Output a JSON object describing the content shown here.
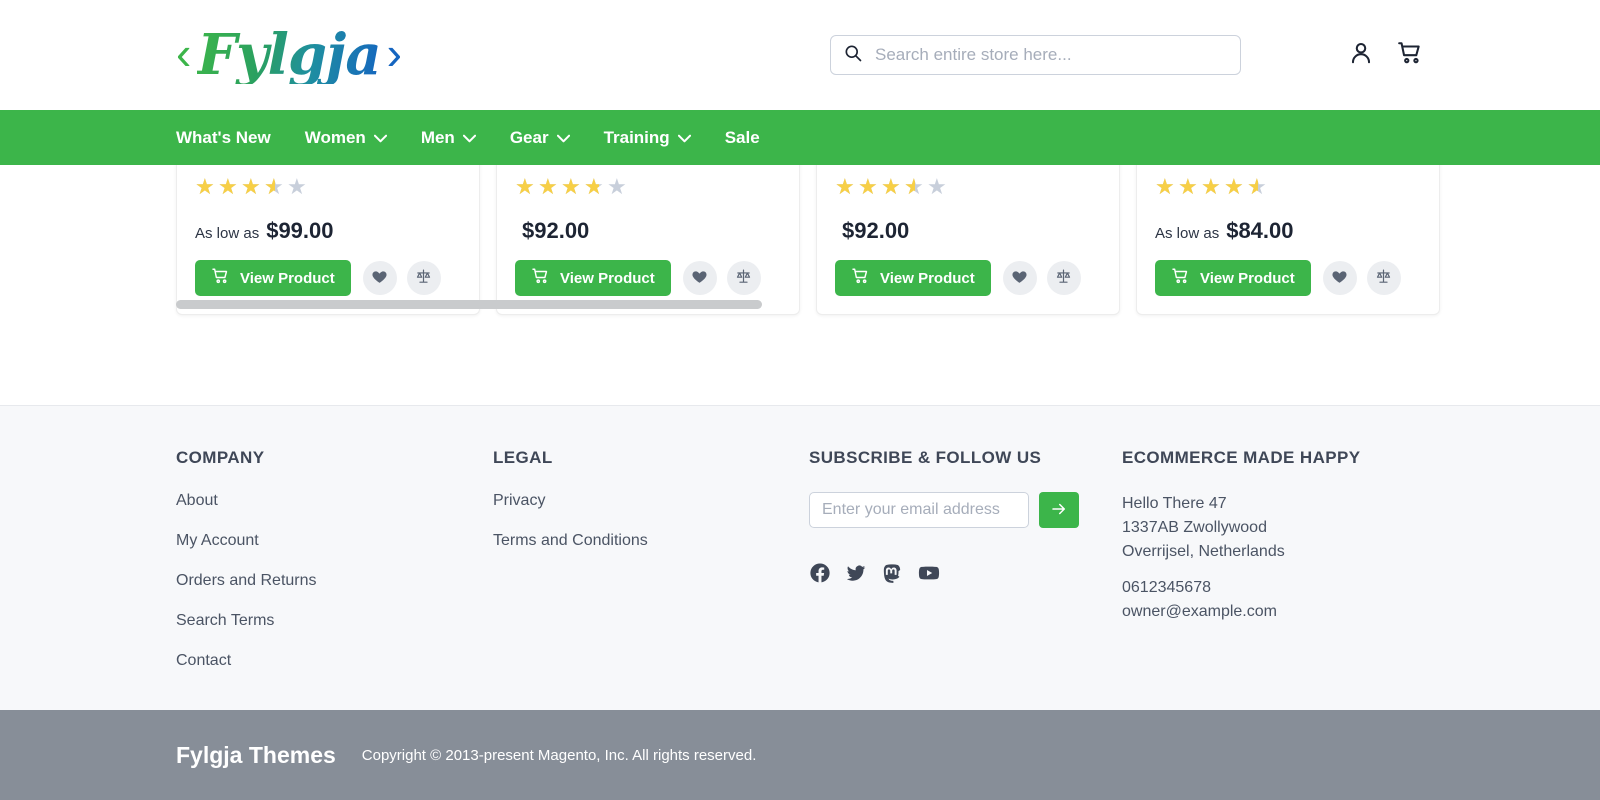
{
  "header": {
    "logo": {
      "left_chevron": "‹",
      "word": "Fylgja",
      "right_chevron": "›"
    },
    "search": {
      "placeholder": "Search entire store here...",
      "value": "",
      "icon": "search-icon"
    },
    "account_icon": "user-account-icon",
    "cart_icon": "shopping-cart-icon"
  },
  "nav": {
    "items": [
      {
        "label": "What's New",
        "has_dropdown": false
      },
      {
        "label": "Women",
        "has_dropdown": true
      },
      {
        "label": "Men",
        "has_dropdown": true
      },
      {
        "label": "Gear",
        "has_dropdown": true
      },
      {
        "label": "Training",
        "has_dropdown": true
      },
      {
        "label": "Sale",
        "has_dropdown": false
      }
    ],
    "background_color": "#3cb54a"
  },
  "products": {
    "view_product_label": "View Product",
    "wishlist_icon": "heart-icon",
    "compare_icon": "compare-scales-icon",
    "cards": [
      {
        "rating": 3.5,
        "price_prefix": "As low as",
        "price": "$99.00"
      },
      {
        "rating": 3.7,
        "price_prefix": "",
        "price": "$92.00"
      },
      {
        "rating": 3.5,
        "price_prefix": "",
        "price": "$92.00"
      },
      {
        "rating": 4.5,
        "price_prefix": "As low as",
        "price": "$84.00"
      }
    ]
  },
  "footer": {
    "company": {
      "title": "COMPANY",
      "links": [
        "About",
        "My Account",
        "Orders and Returns",
        "Search Terms",
        "Contact"
      ]
    },
    "legal": {
      "title": "LEGAL",
      "links": [
        "Privacy",
        "Terms and Conditions"
      ]
    },
    "subscribe": {
      "title": "SUBSCRIBE & FOLLOW US",
      "placeholder": "Enter your email address",
      "value": "",
      "submit_icon": "arrow-right-icon",
      "socials": [
        "facebook-icon",
        "twitter-icon",
        "mastodon-icon",
        "youtube-icon"
      ]
    },
    "address": {
      "title": "ECOMMERCE MADE HAPPY",
      "line1": "Hello There 47",
      "line2": "1337AB Zwollywood",
      "line3": "Overrijsel, Netherlands",
      "phone": "0612345678",
      "email": "owner@example.com"
    }
  },
  "bottom_bar": {
    "brand": "Fylgja Themes",
    "copyright": "Copyright © 2013-present Magento, Inc. All rights reserved."
  },
  "colors": {
    "brand_green": "#3cb54a",
    "brand_blue": "#1565c0",
    "star_gold": "#f7cf46",
    "footer_bg": "#f7f8fa",
    "bottom_bar_bg": "#878e98"
  }
}
